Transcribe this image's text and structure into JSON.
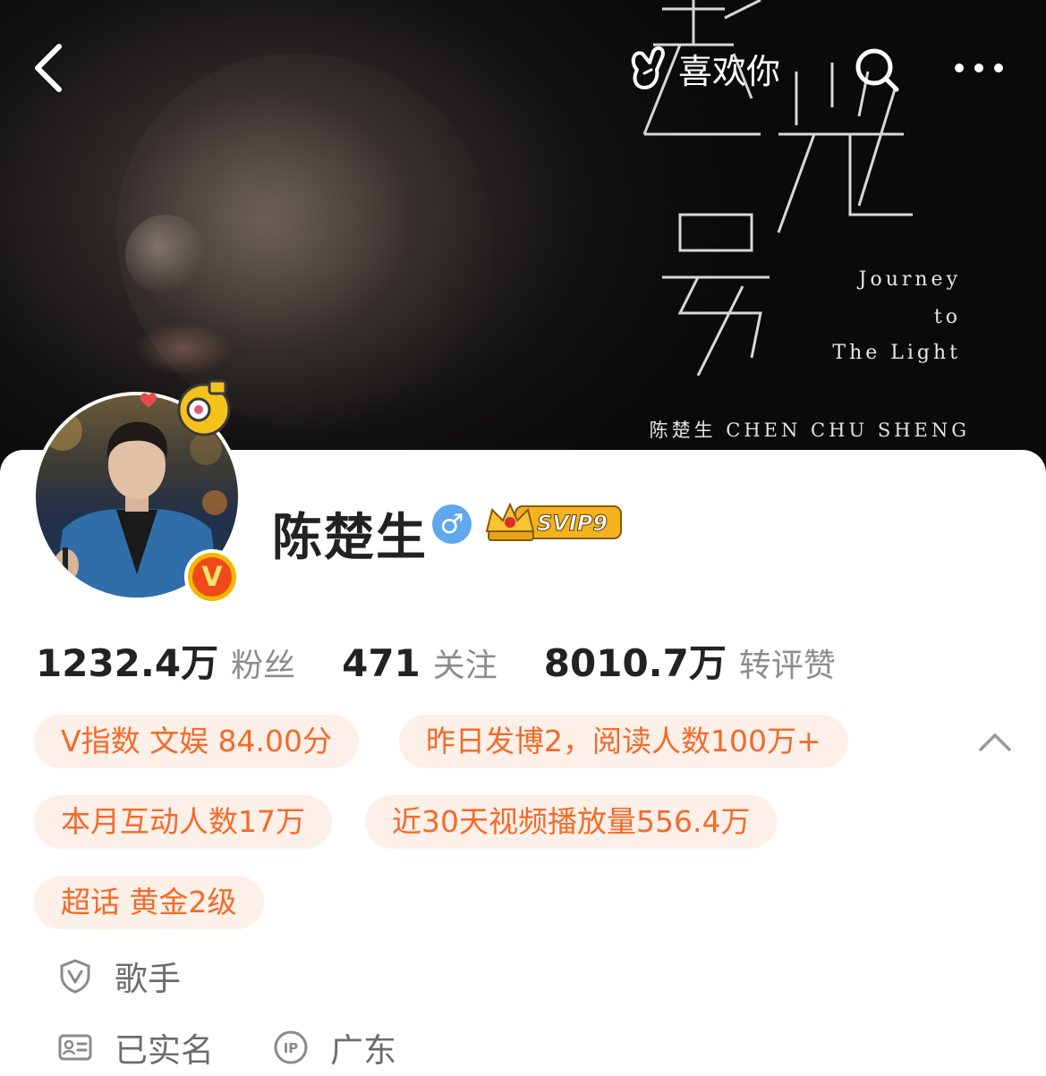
{
  "nav": {
    "like_label": "喜欢你"
  },
  "cover": {
    "title_chars": [
      "超",
      "光",
      "号"
    ],
    "subtitle_line1": "Journey",
    "subtitle_line2": "to",
    "subtitle_line3": "The Light",
    "credit": "陈楚生  CHEN CHU SHENG"
  },
  "profile": {
    "name": "陈楚生",
    "gender": "♂",
    "svip": "SVIP9",
    "verified_badge": "V"
  },
  "stats": [
    {
      "value": "1232.4万",
      "label": "粉丝"
    },
    {
      "value": "471",
      "label": "关注"
    },
    {
      "value": "8010.7万",
      "label": "转评赞"
    }
  ],
  "chips": [
    "V指数 文娱 84.00分",
    "昨日发博2，阅读人数100万+",
    "本月互动人数17万",
    "近30天视频播放量556.4万",
    "超话 黄金2级"
  ],
  "info": {
    "occupation": "歌手",
    "realname": "已实名",
    "ip_location": "广东"
  },
  "colors": {
    "accent_orange": "#f36a2b",
    "chip_bg": "#fdf0e8",
    "gender_blue": "#5fa8ec",
    "verified_gold": "#f5b800"
  }
}
